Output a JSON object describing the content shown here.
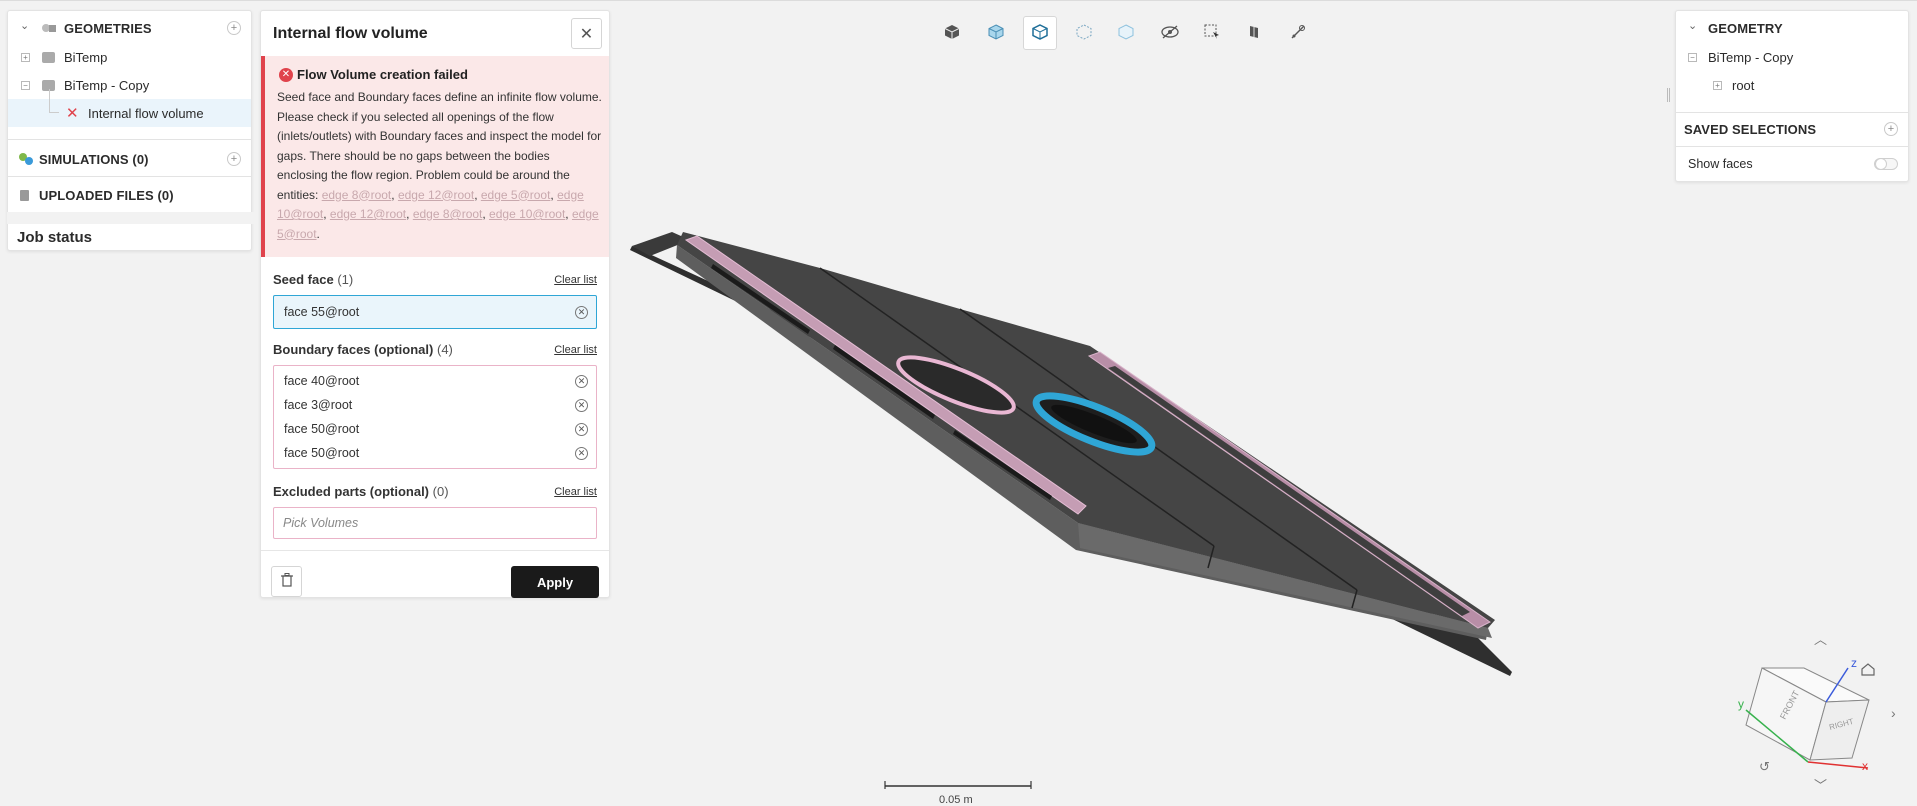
{
  "left_panel": {
    "geometries_header": "GEOMETRIES",
    "tree": [
      {
        "label": "BiTemp"
      },
      {
        "label": "BiTemp - Copy"
      },
      {
        "label": "Internal flow volume"
      }
    ],
    "simulations_header": "SIMULATIONS (0)",
    "uploaded_header": "UPLOADED FILES (0)",
    "job_status": "Job status"
  },
  "dialog": {
    "title": "Internal flow volume",
    "error": {
      "title": "Flow Volume creation failed",
      "message": "Seed face and Boundary faces define an infinite flow volume. Please check if you selected all openings of the flow (inlets/outlets) with Boundary faces and inspect the model for gaps. There should be no gaps between the bodies enclosing the flow region. Problem could be around the entities: ",
      "entities": [
        "edge 8@root",
        "edge 12@root",
        "edge 5@root",
        "edge 10@root",
        "edge 12@root",
        "edge 8@root",
        "edge 10@root",
        "edge 5@root"
      ]
    },
    "seed_face": {
      "label": "Seed face",
      "count": "(1)",
      "clear": "Clear list",
      "items": [
        "face 55@root"
      ]
    },
    "boundary_faces": {
      "label": "Boundary faces (optional)",
      "count": "(4)",
      "clear": "Clear list",
      "items": [
        "face 40@root",
        "face 3@root",
        "face 50@root",
        "face 50@root"
      ]
    },
    "excluded_parts": {
      "label": "Excluded parts (optional)",
      "count": "(0)",
      "clear": "Clear list",
      "placeholder": "Pick Volumes"
    },
    "apply_label": "Apply"
  },
  "right_panel": {
    "geometry_header": "GEOMETRY",
    "tree": [
      {
        "label": "BiTemp - Copy"
      },
      {
        "label": "root"
      }
    ],
    "saved_selections": "SAVED SELECTIONS",
    "show_faces": "Show faces",
    "show_faces_on": false
  },
  "toolbar": {
    "icons": [
      "solid-view-icon",
      "transparent-view-icon",
      "selected-view-icon",
      "wireframe-view-icon",
      "outline-view-icon",
      "hide-icon",
      "box-select-icon",
      "section-icon",
      "measure-icon"
    ],
    "active_index": 2
  },
  "viewport": {
    "scale_label": "0.05 m",
    "axes": {
      "x": "x",
      "y": "y",
      "z": "z"
    },
    "cube_faces": {
      "front": "FRONT",
      "right": "RIGHT"
    }
  },
  "colors": {
    "accent": "#2fa6d6",
    "error": "#e0434c",
    "selection_pink": "#c98fb0",
    "model_dark": "#454545"
  }
}
